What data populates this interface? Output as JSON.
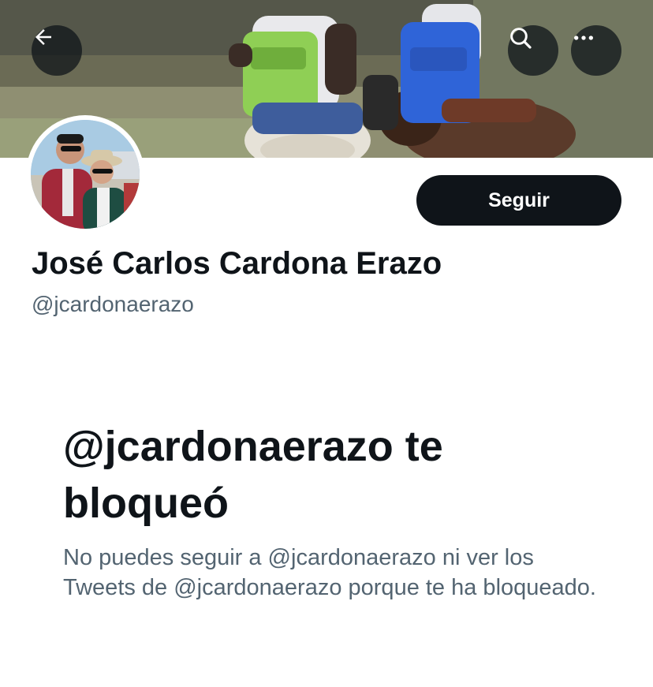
{
  "header": {
    "back_icon": "arrow-left-icon",
    "search_icon": "search-icon",
    "more_icon": "more-horizontal-icon"
  },
  "profile": {
    "display_name": "José Carlos Cardona Erazo",
    "handle": "@jcardonaerazo",
    "follow_label": "Seguir"
  },
  "blocked": {
    "title": "@jcardonaerazo te bloqueó",
    "description": "No puedes seguir a @jcardonaerazo ni ver los Tweets de @jcardonaerazo porque te ha bloqueado."
  },
  "colors": {
    "primary_text": "#0f1419",
    "secondary_text": "#536471",
    "button_bg": "#0f1419",
    "button_text": "#ffffff"
  }
}
